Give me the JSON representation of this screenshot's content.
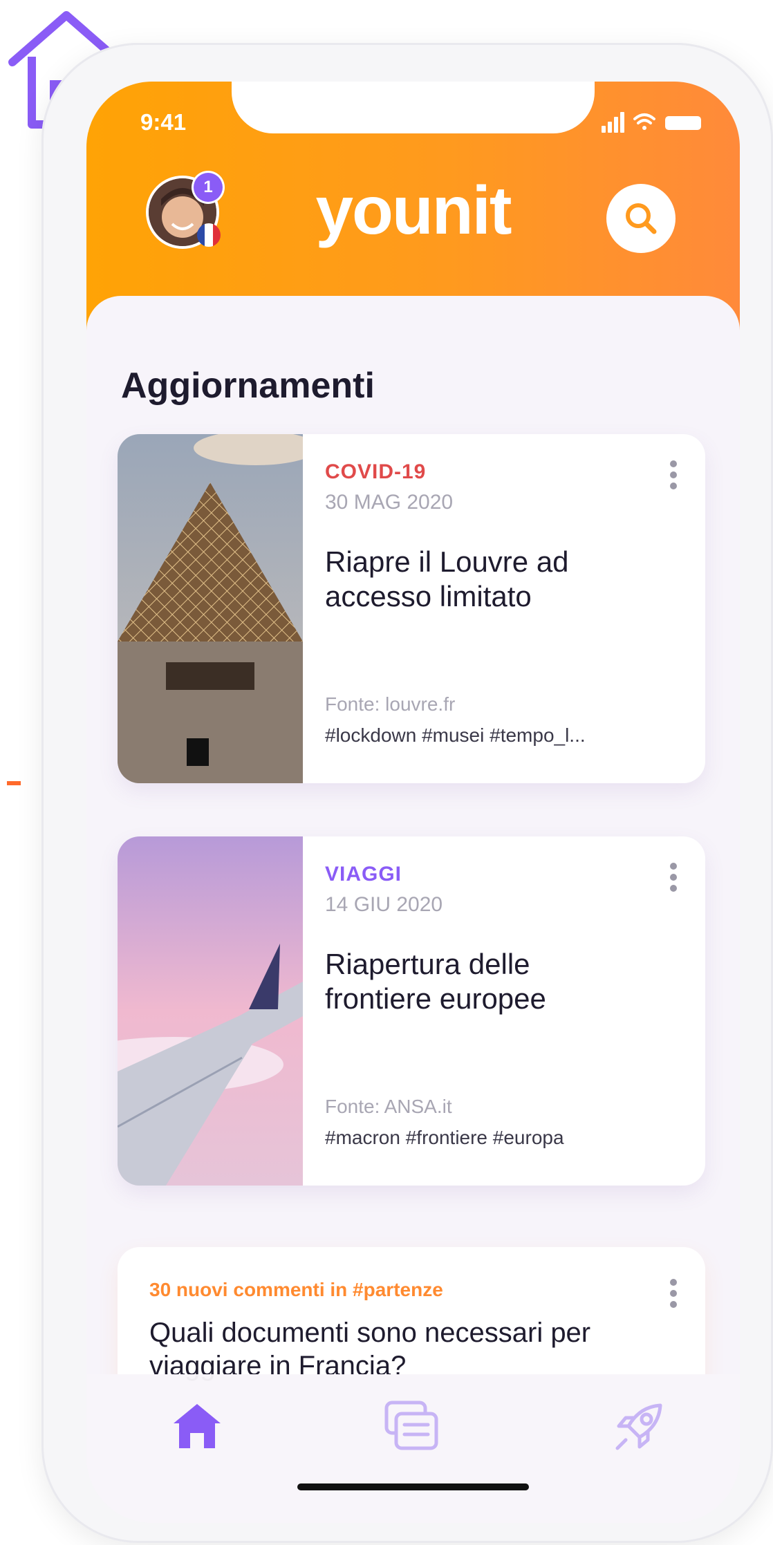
{
  "status_bar": {
    "time": "9:41"
  },
  "header": {
    "brand": "younit",
    "notification_count": "1"
  },
  "section": {
    "title": "Aggiornamenti"
  },
  "cards": [
    {
      "category": "COVID-19",
      "category_color": "#e04a4a",
      "date": "30 MAG 2020",
      "headline": "Riapre il Louvre ad accesso limitato",
      "source": "Fonte: louvre.fr",
      "tags": "#lockdown #musei #tempo_l..."
    },
    {
      "category": "VIAGGI",
      "category_color": "#8a5cf6",
      "date": "14 GIU 2020",
      "headline": "Riapertura delle frontiere europee",
      "source": "Fonte: ANSA.it",
      "tags": "#macron #frontiere #europa"
    }
  ],
  "discussion": {
    "meta": "30 nuovi commenti in #partenze",
    "title": "Quali documenti sono necessari per viaggiare in Francia?"
  },
  "tabbar": {
    "items": [
      {
        "icon": "home-icon",
        "active": true
      },
      {
        "icon": "chat-icon",
        "active": false
      },
      {
        "icon": "rocket-icon",
        "active": false
      }
    ]
  },
  "colors": {
    "accent": "#8a5cf6",
    "header_orange": "#ffa305",
    "comment_orange": "#ff8a30"
  }
}
